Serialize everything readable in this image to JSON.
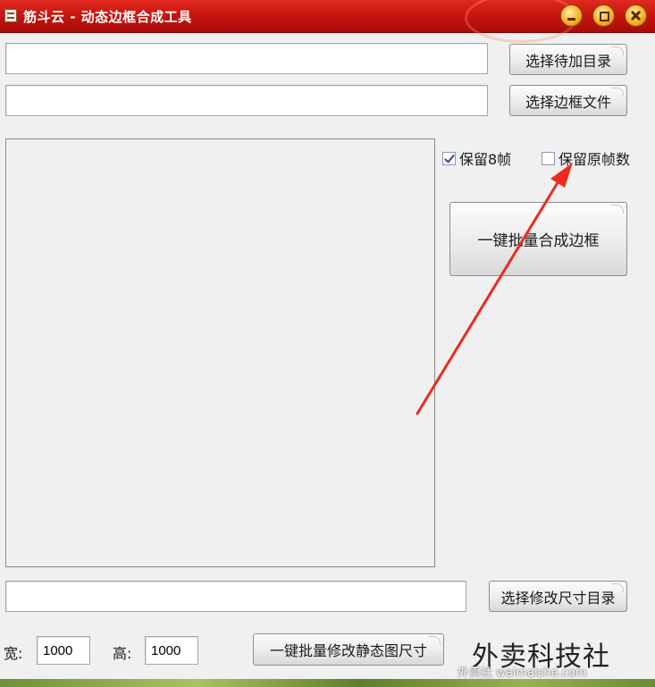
{
  "window": {
    "title": "筋斗云 - 动态边框合成工具",
    "controls": {
      "minimize_icon": "minimize-icon",
      "maximize_icon": "maximize-icon",
      "close_icon": "close-icon"
    },
    "accent_color": "#c8150f"
  },
  "inputs": {
    "target_dir": {
      "value": "",
      "placeholder": ""
    },
    "frame_file": {
      "value": "",
      "placeholder": ""
    },
    "resize_dir": {
      "value": "",
      "placeholder": ""
    },
    "width": {
      "value": "1000"
    },
    "height": {
      "value": "1000"
    }
  },
  "buttons": {
    "select_target_dir": "选择待加目录",
    "select_frame_file": "选择边框文件",
    "batch_compose": "一键批量合成边框",
    "select_resize_dir": "选择修改尺寸目录",
    "batch_resize": "一键批量修改静态图尺寸"
  },
  "options": {
    "keep_8_frames": {
      "label": "保留8帧",
      "checked": true
    },
    "keep_original_frames": {
      "label": "保留原帧数",
      "checked": false
    }
  },
  "labels": {
    "width": "宽:",
    "height": "高:"
  },
  "watermark": {
    "big": "外卖科技社",
    "small": "外卖社 waimaishe.com"
  },
  "annotation": {
    "arrow_color": "#ee2a1e"
  }
}
